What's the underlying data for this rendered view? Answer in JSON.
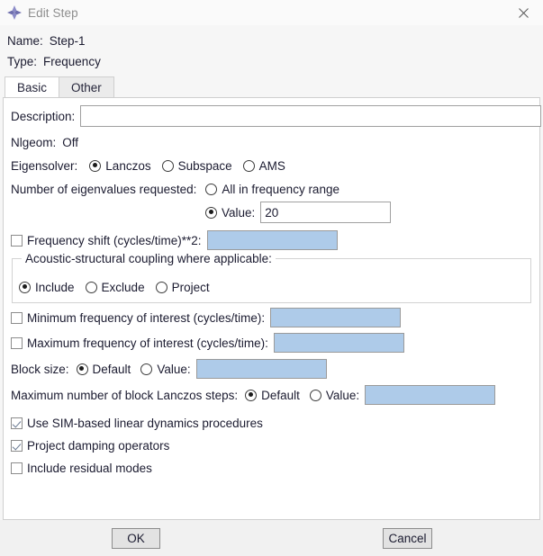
{
  "window": {
    "title": "Edit Step",
    "icon": "abaqus-diamond-icon",
    "close_icon": "close-icon"
  },
  "header": {
    "name_label": "Name:",
    "name_value": "Step-1",
    "type_label": "Type:",
    "type_value": "Frequency"
  },
  "tabs": [
    {
      "label": "Basic",
      "active": true
    },
    {
      "label": "Other",
      "active": false
    }
  ],
  "form": {
    "description_label": "Description:",
    "description_value": "",
    "nlgeom_label": "Nlgeom:",
    "nlgeom_value": "Off",
    "eigensolver_label": "Eigensolver:",
    "eigensolver_options": [
      {
        "label": "Lanczos",
        "selected": true
      },
      {
        "label": "Subspace",
        "selected": false
      },
      {
        "label": "AMS",
        "selected": false
      }
    ],
    "num_eigen_label": "Number of eigenvalues requested:",
    "num_eigen_all_label": "All in frequency range",
    "num_eigen_all_selected": false,
    "num_eigen_value_label": "Value:",
    "num_eigen_value_selected": true,
    "num_eigen_value": "20",
    "freq_shift_label": "Frequency shift (cycles/time)**2:",
    "freq_shift_checked": false,
    "freq_shift_value": "",
    "acoustic_group_title": "Acoustic-structural coupling where applicable:",
    "acoustic_options": [
      {
        "label": "Include",
        "selected": true
      },
      {
        "label": "Exclude",
        "selected": false
      },
      {
        "label": "Project",
        "selected": false
      }
    ],
    "min_freq_label": "Minimum frequency of interest (cycles/time):",
    "min_freq_checked": false,
    "min_freq_value": "",
    "max_freq_label": "Maximum frequency of interest (cycles/time):",
    "max_freq_checked": false,
    "max_freq_value": "",
    "block_size_label": "Block size:",
    "block_size_default_label": "Default",
    "block_size_default_selected": true,
    "block_size_value_label": "Value:",
    "block_size_value_selected": false,
    "block_size_value": "",
    "max_steps_label": "Maximum number of block Lanczos steps:",
    "max_steps_default_label": "Default",
    "max_steps_default_selected": true,
    "max_steps_value_label": "Value:",
    "max_steps_value_selected": false,
    "max_steps_value": "",
    "sim_label": "Use SIM-based linear dynamics procedures",
    "sim_checked": true,
    "project_damping_label": "Project damping operators",
    "project_damping_checked": true,
    "residual_modes_label": "Include residual modes",
    "residual_modes_checked": false
  },
  "footer": {
    "ok_label": "OK",
    "cancel_label": "Cancel"
  },
  "colors": {
    "disabled_field": "#aecbe9",
    "panel_bg": "#ffffff",
    "window_bg": "#f6f6f6",
    "title_icon": "#7b7bbb"
  }
}
